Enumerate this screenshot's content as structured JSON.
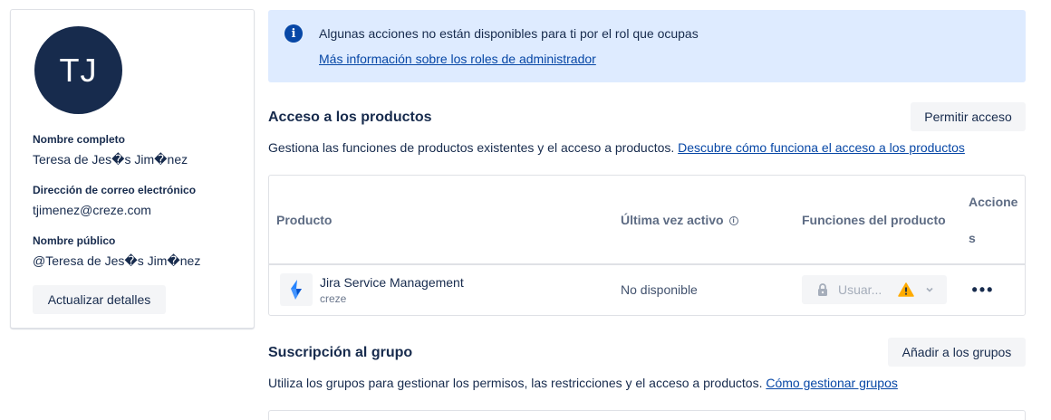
{
  "profile": {
    "initials": "TJ",
    "full_name_label": "Nombre completo",
    "full_name": "Teresa de Jes�s Jim�nez",
    "email_label": "Dirección de correo electrónico",
    "email": "tjimenez@creze.com",
    "public_name_label": "Nombre público",
    "public_name": "@Teresa de Jes�s Jim�nez",
    "update_button": "Actualizar detalles"
  },
  "banner": {
    "message": "Algunas acciones no están disponibles para ti por el rol que ocupas",
    "link": "Más información sobre los roles de administrador"
  },
  "product_access": {
    "title": "Acceso a los productos",
    "grant_button": "Permitir acceso",
    "description": "Gestiona las funciones de productos existentes y el acceso a productos.",
    "description_link": "Descubre cómo funciona el acceso a los productos",
    "columns": {
      "product": "Producto",
      "last_active": "Última vez activo",
      "roles": "Funciones del producto",
      "actions_line1": "Accione",
      "actions_line2": "s"
    },
    "rows": [
      {
        "product": "Jira Service Management",
        "site": "creze",
        "last_active": "No disponible",
        "role": "Usuar..."
      }
    ]
  },
  "groups": {
    "title": "Suscripción al grupo",
    "add_button": "Añadir a los grupos",
    "description": "Utiliza los grupos para gestionar los permisos, las restricciones y el acceso a productos.",
    "description_link": "Cómo gestionar grupos"
  },
  "colors": {
    "avatar_bg": "#172b4d",
    "banner_bg": "#deebff",
    "link": "#0747a6",
    "warning": "#ffab00",
    "jira_blue": "#2684ff"
  },
  "icons": {
    "banner": "info-icon",
    "last_active_help": "info-icon",
    "product_logo": "jira-service-management-icon",
    "role_lock": "lock-icon",
    "role_warning": "warning-icon",
    "role_dropdown": "chevron-down-icon",
    "actions": "more-icon"
  }
}
